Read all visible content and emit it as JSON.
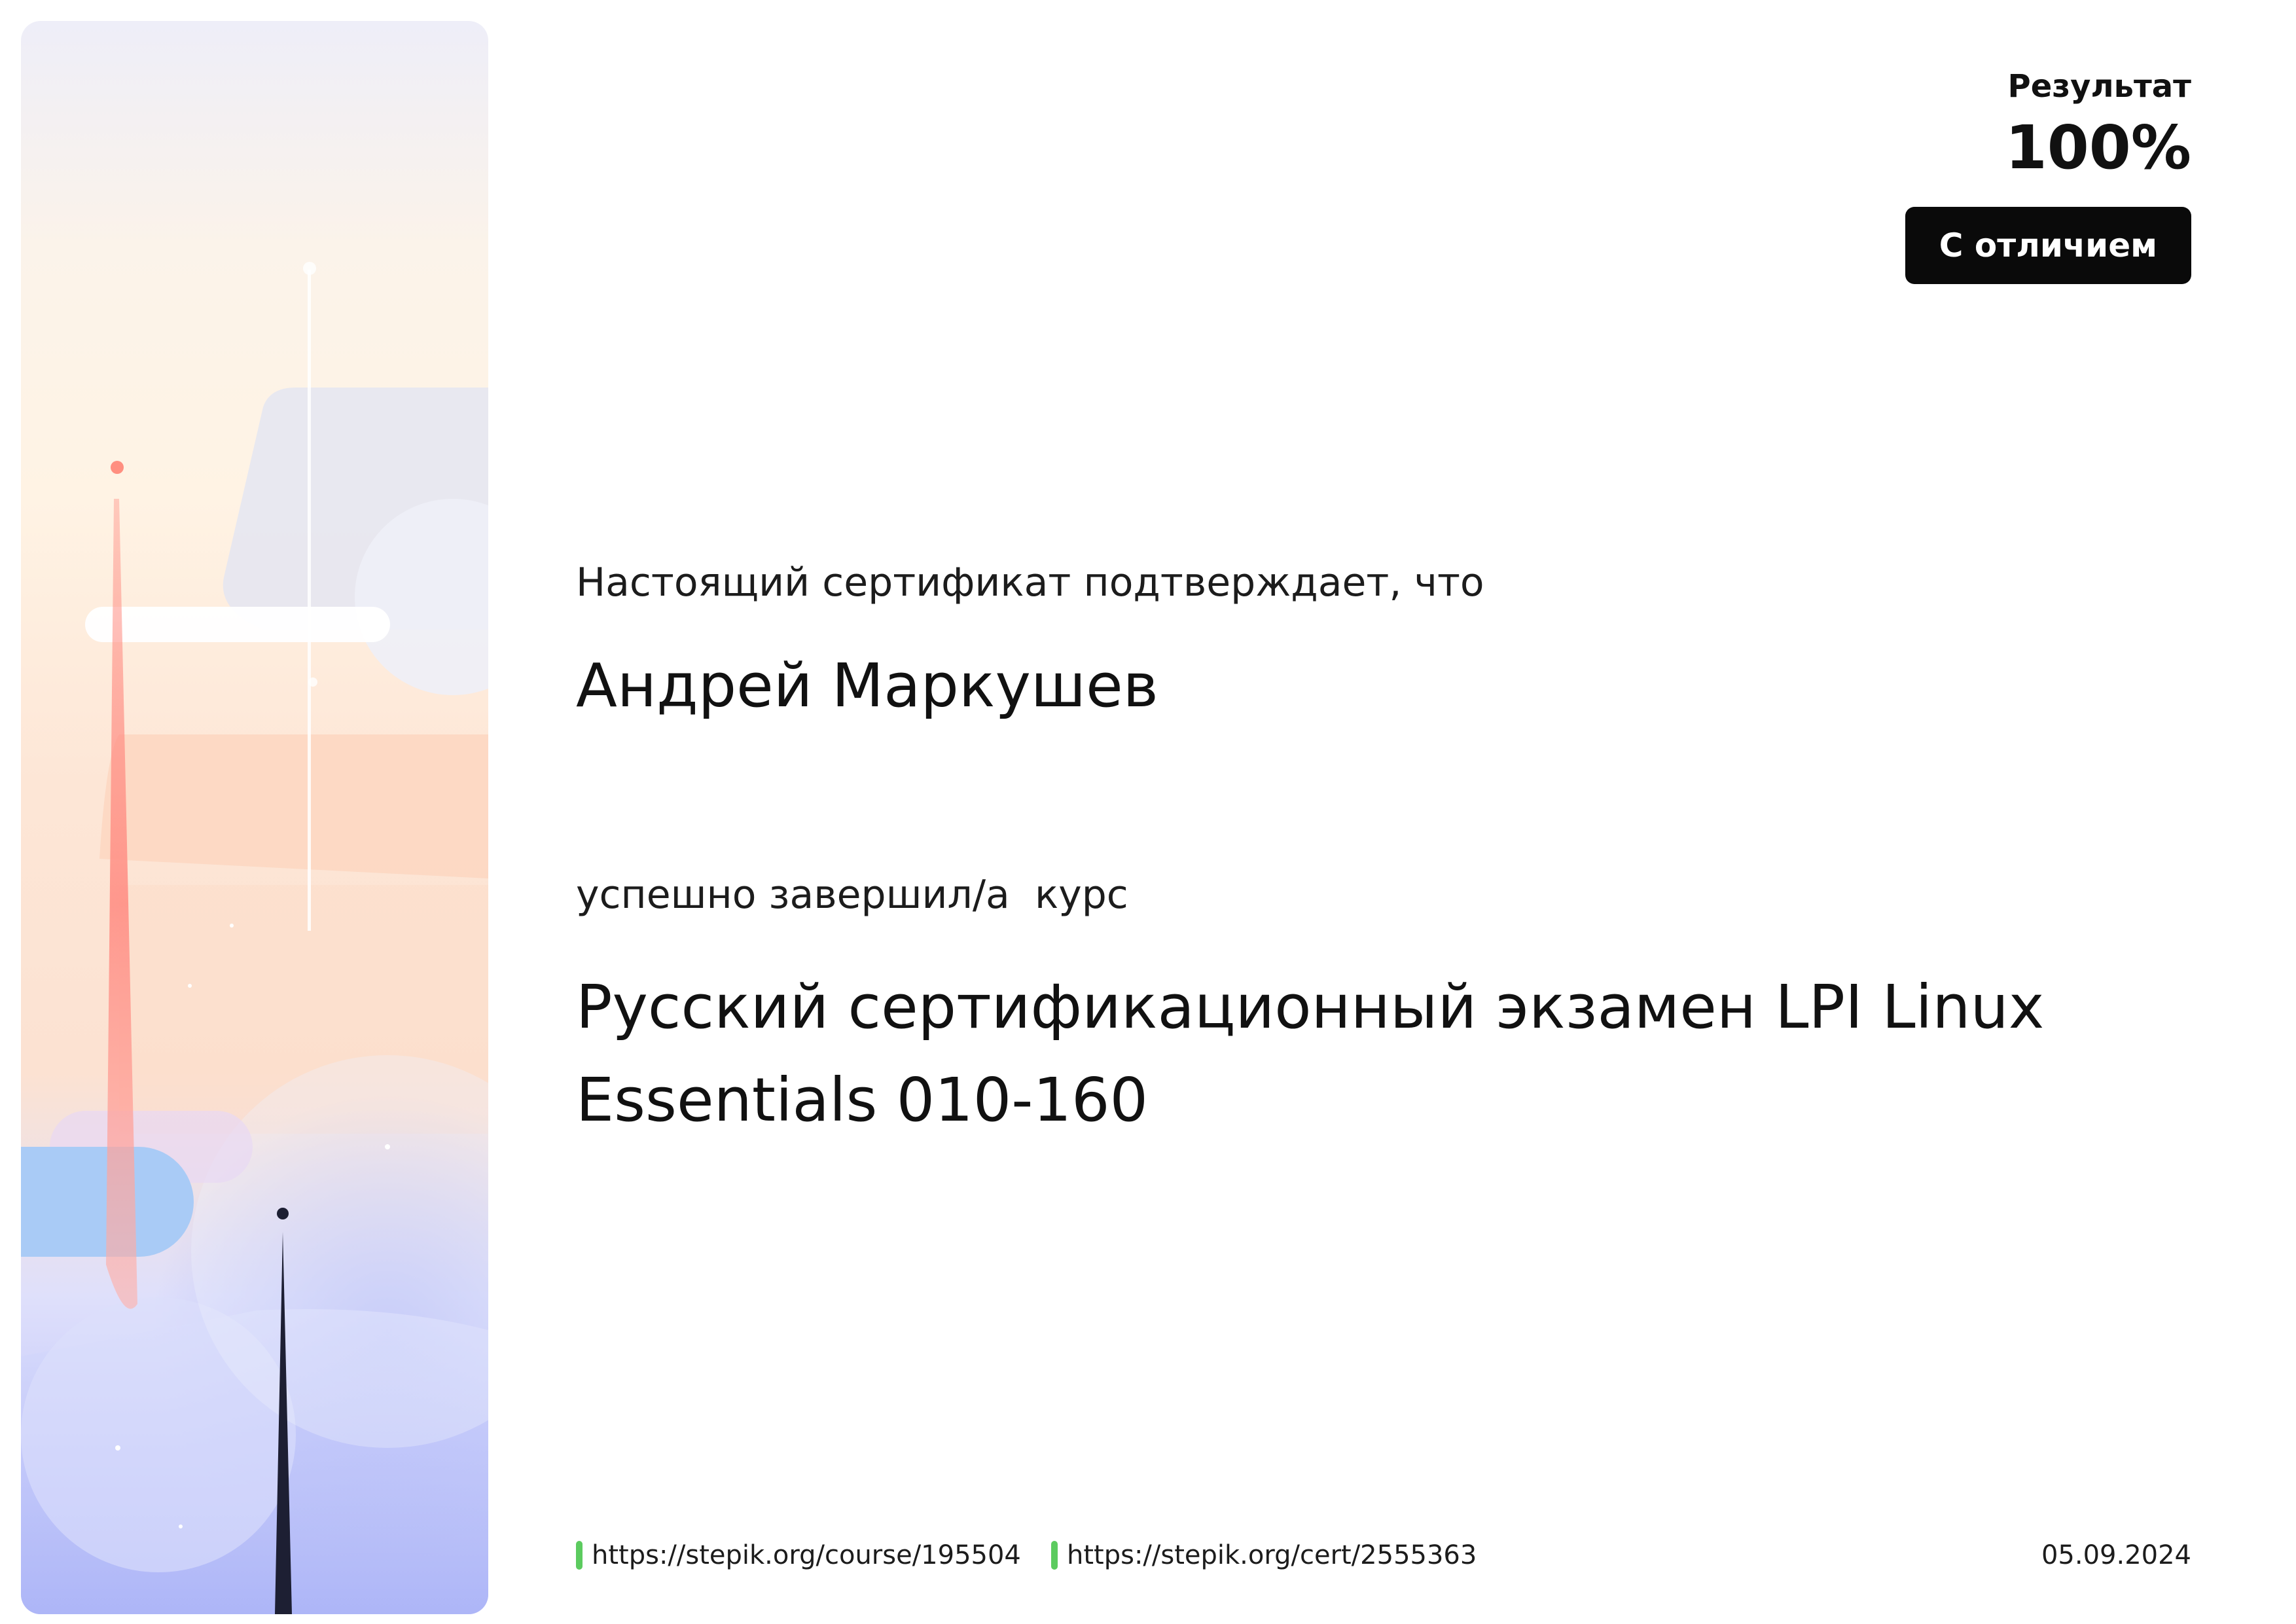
{
  "result": {
    "label": "Результат",
    "value": "100%",
    "badge": "С отличием"
  },
  "certificate": {
    "intro": "Настоящий сертификат подтверждает, что",
    "recipient": "Андрей Маркушев",
    "completed": "успешно завершил/а  курс",
    "course_title": "Русский сертификационный экзамен LPI Linux Essentials 010-160"
  },
  "footer": {
    "course_url": "https://stepik.org/course/195504",
    "cert_url": "https://stepik.org/cert/2555363",
    "date": "05.09.2024"
  },
  "colors": {
    "link_marker": "#5ccb5f",
    "badge_bg": "#0a0a0a",
    "badge_text": "#ffffff"
  }
}
